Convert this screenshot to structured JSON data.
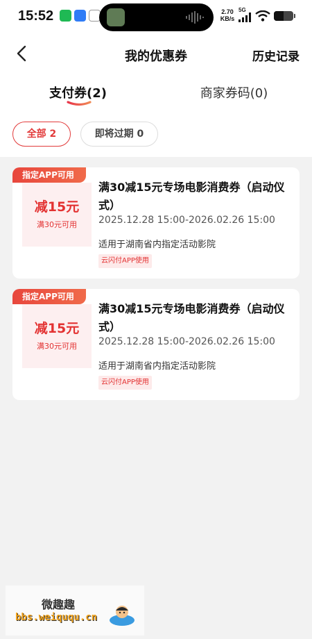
{
  "status_bar": {
    "time": "15:52",
    "net_speed_value": "2.70",
    "net_speed_unit": "KB/s",
    "network": "5G",
    "battery_level": 0.5
  },
  "header": {
    "title": "我的优惠券",
    "history": "历史记录"
  },
  "tabs": [
    {
      "label": "支付券(2)",
      "active": true
    },
    {
      "label": "商家券码(0)",
      "active": false
    }
  ],
  "filters": [
    {
      "label": "全部 2",
      "active": true
    },
    {
      "label": "即将过期 0",
      "active": false
    }
  ],
  "coupons": [
    {
      "tag": "指定APP可用",
      "amount": "减15元",
      "condition": "满30元可用",
      "title": "满30减15元专场电影消费券（启动仪式）",
      "time": "2025.12.28 15:00-2026.02.26 15:00",
      "scope": "适用于湖南省内指定活动影院",
      "channel": "云闪付APP使用"
    },
    {
      "tag": "指定APP可用",
      "amount": "减15元",
      "condition": "满30元可用",
      "title": "满30减15元专场电影消费券（启动仪式）",
      "time": "2025.12.28 15:00-2026.02.26 15:00",
      "scope": "适用于湖南省内指定活动影院",
      "channel": "云闪付APP使用"
    }
  ],
  "watermark": {
    "title": "微趣趣",
    "url": "bbs.weiququ.cn"
  },
  "colors": {
    "accent": "#e33232",
    "page_bg": "#f2f2f2",
    "card_bg": "#ffffff",
    "value_bg": "#fdeff0"
  }
}
